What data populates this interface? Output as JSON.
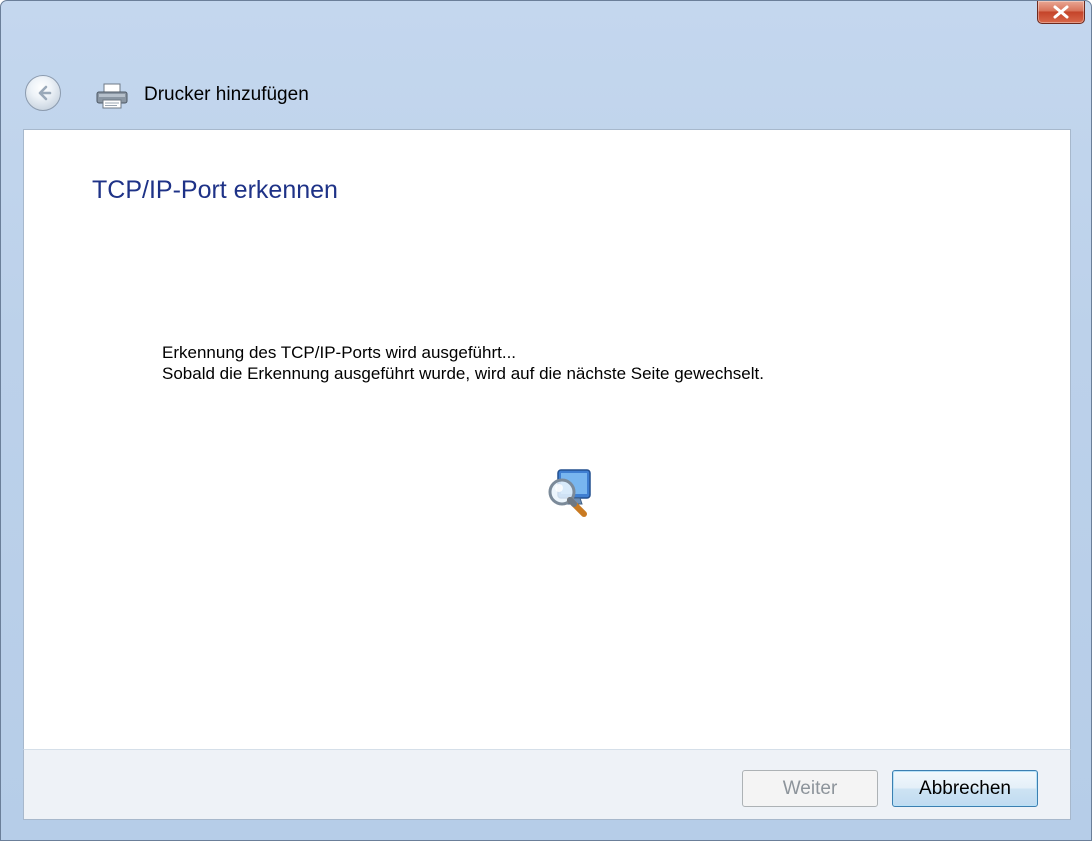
{
  "window": {
    "title": "Drucker hinzufügen"
  },
  "titlebar": {
    "close_icon": "close-icon"
  },
  "nav": {
    "back_icon": "back-arrow-icon",
    "app_icon": "printer-icon"
  },
  "content": {
    "heading": "TCP/IP-Port erkennen",
    "status_line1": "Erkennung des TCP/IP-Ports wird ausgeführt...",
    "status_line2": "Sobald die Erkennung ausgeführt wurde, wird auf die nächste Seite gewechselt.",
    "animation_icon": "network-search-icon"
  },
  "footer": {
    "next_label": "Weiter",
    "next_enabled": false,
    "cancel_label": "Abbrechen"
  },
  "colors": {
    "heading": "#1e3287",
    "frame": "#c4d7ee",
    "close_button": "#c4442a"
  }
}
